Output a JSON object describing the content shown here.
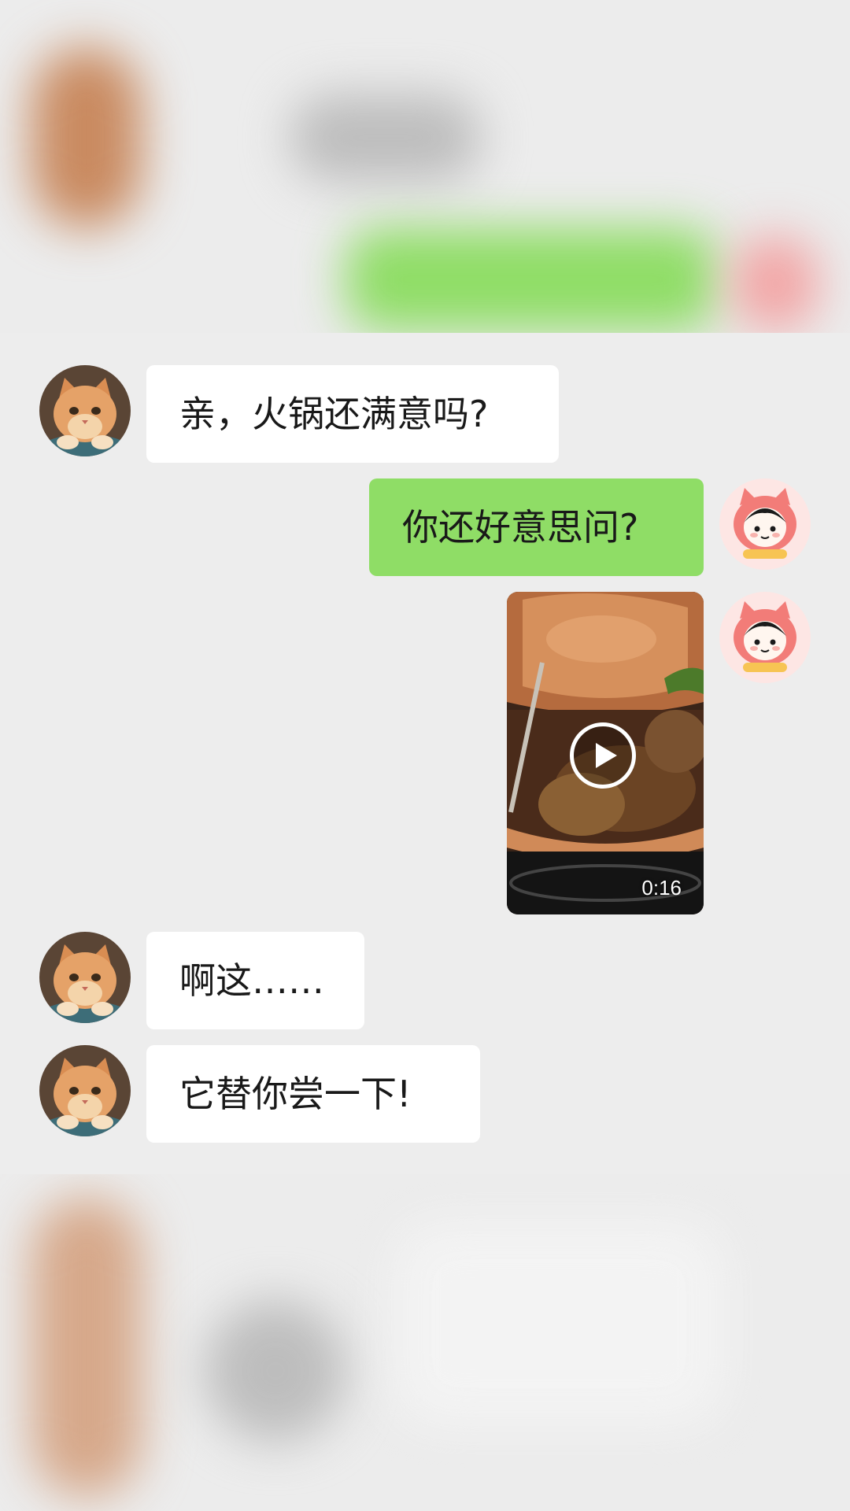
{
  "conversation": {
    "messages": [
      {
        "sender": "cat",
        "type": "text",
        "text": "亲，火锅还满意吗?"
      },
      {
        "sender": "me",
        "type": "text",
        "text": "你还好意思问?"
      },
      {
        "sender": "me",
        "type": "video",
        "duration": "0:16"
      },
      {
        "sender": "cat",
        "type": "text",
        "text": "啊这……"
      },
      {
        "sender": "cat",
        "type": "text",
        "text": "它替你尝一下!"
      }
    ]
  },
  "icons": {
    "cat_avatar": "cat-avatar-icon",
    "user_avatar": "cartoon-girl-avatar-icon",
    "play": "play-icon"
  },
  "colors": {
    "chat_background": "#ededed",
    "incoming_bubble": "#ffffff",
    "outgoing_bubble": "#8fdd66",
    "text": "#191919"
  }
}
